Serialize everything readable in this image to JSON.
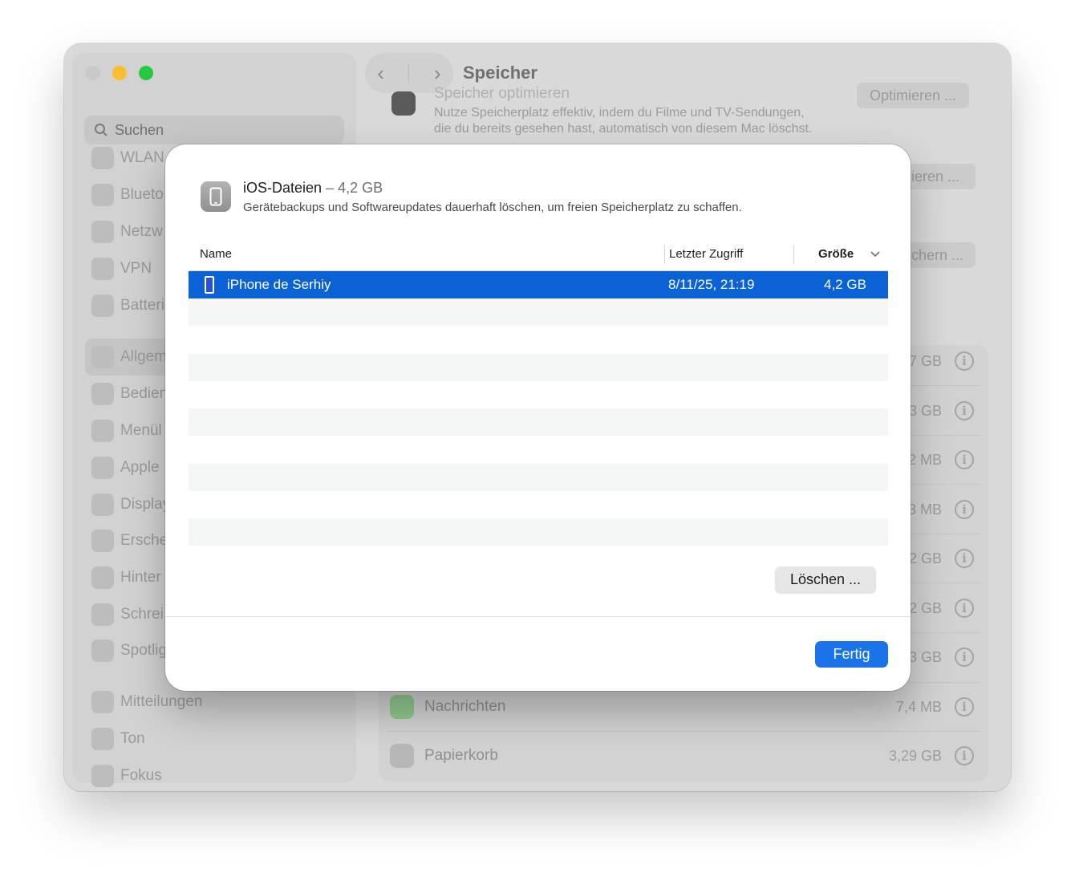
{
  "window": {
    "title": "Speicher"
  },
  "sidebar": {
    "search_placeholder": "Suchen",
    "items": [
      {
        "label": "WLAN",
        "icon": "wifi-icon"
      },
      {
        "label": "Blueto",
        "icon": "bluetooth-icon"
      },
      {
        "label": "Netzw",
        "icon": "network-icon"
      },
      {
        "label": "VPN",
        "icon": "vpn-icon"
      },
      {
        "label": "Batteri",
        "icon": "battery-icon"
      },
      {
        "label": "Allgem",
        "icon": "gear-icon"
      },
      {
        "label": "Bedien",
        "icon": "accessibility-icon"
      },
      {
        "label": "Menül",
        "icon": "menubar-icon"
      },
      {
        "label": "Apple",
        "icon": "apple-intelligence-icon"
      },
      {
        "label": "Display",
        "icon": "display-icon"
      },
      {
        "label": "Ersche",
        "icon": "appearance-icon"
      },
      {
        "label": "Hinter",
        "icon": "wallpaper-icon"
      },
      {
        "label": "Schrei",
        "icon": "screensaver-icon"
      },
      {
        "label": "Spotlig",
        "icon": "spotlight-icon"
      },
      {
        "label": "Mitteilungen",
        "icon": "notifications-icon"
      },
      {
        "label": "Ton",
        "icon": "sound-icon"
      },
      {
        "label": "Fokus",
        "icon": "focus-icon"
      }
    ]
  },
  "background": {
    "optimize_title": "Speicher optimieren",
    "optimize_desc_1": "Nutze Speicherplatz effektiv, indem du Filme und TV-Sendungen,",
    "optimize_desc_2": "die du bereits gesehen hast, automatisch von diesem Mac löschst.",
    "optimize_button": "Optimieren ...",
    "button_2": "ieren ...",
    "button_3": "chern ...",
    "rows": [
      {
        "size": "7 GB"
      },
      {
        "size": "3 GB"
      },
      {
        "size": "2 MB"
      },
      {
        "size": "3 MB"
      },
      {
        "size": "2 GB"
      },
      {
        "size": "2 GB"
      },
      {
        "size": "3 GB"
      },
      {
        "label": "Nachrichten",
        "size": "7,4 MB"
      },
      {
        "label": "Papierkorb",
        "size": "3,29 GB"
      }
    ]
  },
  "sheet": {
    "title": "iOS-Dateien",
    "dash": "–",
    "size": "4,2 GB",
    "subtitle": "Gerätebackups und Softwareupdates dauerhaft löschen, um freien Speicherplatz zu schaffen.",
    "columns": {
      "name": "Name",
      "last_access": "Letzter Zugriff",
      "size": "Größe"
    },
    "rows": [
      {
        "name": "iPhone de Serhiy",
        "last_access": "8/11/25, 21:19",
        "size": "4,2 GB",
        "selected": true
      }
    ],
    "delete_button": "Löschen ...",
    "done_button": "Fertig"
  },
  "colors": {
    "accent": "#0a62d4",
    "button_primary": "#1a73e8"
  }
}
